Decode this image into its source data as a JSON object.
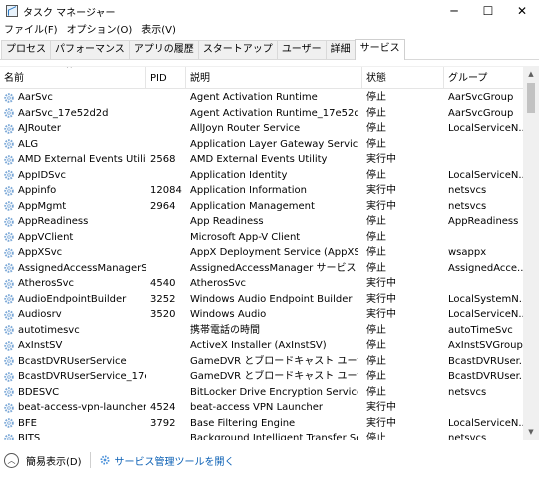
{
  "window": {
    "title": "タスク マネージャー",
    "minimize_glyph": "─",
    "maximize_glyph": "☐",
    "close_glyph": "✕"
  },
  "menu": [
    "ファイル(F)",
    "オプション(O)",
    "表示(V)"
  ],
  "tabs": [
    {
      "label": "プロセス",
      "active": false
    },
    {
      "label": "パフォーマンス",
      "active": false
    },
    {
      "label": "アプリの履歴",
      "active": false
    },
    {
      "label": "スタートアップ",
      "active": false
    },
    {
      "label": "ユーザー",
      "active": false
    },
    {
      "label": "詳細",
      "active": false
    },
    {
      "label": "サービス",
      "active": true
    }
  ],
  "columns": {
    "name": "名前",
    "pid": "PID",
    "description": "説明",
    "status": "状態",
    "group": "グループ",
    "sort_glyph": "^"
  },
  "rows": [
    {
      "name": "AarSvc",
      "pid": "",
      "description": "Agent Activation Runtime",
      "status": "停止",
      "group": "AarSvcGroup"
    },
    {
      "name": "AarSvc_17e52d2d",
      "pid": "",
      "description": "Agent Activation Runtime_17e52d2d",
      "status": "停止",
      "group": "AarSvcGroup"
    },
    {
      "name": "AJRouter",
      "pid": "",
      "description": "AllJoyn Router Service",
      "status": "停止",
      "group": "LocalServiceN..."
    },
    {
      "name": "ALG",
      "pid": "",
      "description": "Application Layer Gateway Service",
      "status": "停止",
      "group": ""
    },
    {
      "name": "AMD External Events Utility",
      "pid": "2568",
      "description": "AMD External Events Utility",
      "status": "実行中",
      "group": ""
    },
    {
      "name": "AppIDSvc",
      "pid": "",
      "description": "Application Identity",
      "status": "停止",
      "group": "LocalServiceN..."
    },
    {
      "name": "Appinfo",
      "pid": "12084",
      "description": "Application Information",
      "status": "実行中",
      "group": "netsvcs"
    },
    {
      "name": "AppMgmt",
      "pid": "2964",
      "description": "Application Management",
      "status": "実行中",
      "group": "netsvcs"
    },
    {
      "name": "AppReadiness",
      "pid": "",
      "description": "App Readiness",
      "status": "停止",
      "group": "AppReadiness"
    },
    {
      "name": "AppVClient",
      "pid": "",
      "description": "Microsoft App-V Client",
      "status": "停止",
      "group": ""
    },
    {
      "name": "AppXSvc",
      "pid": "",
      "description": "AppX Deployment Service (AppXSVC)",
      "status": "停止",
      "group": "wsappx"
    },
    {
      "name": "AssignedAccessManagerSvc",
      "pid": "",
      "description": "AssignedAccessManager サービス",
      "status": "停止",
      "group": "AssignedAcce..."
    },
    {
      "name": "AtherosSvc",
      "pid": "4540",
      "description": "AtherosSvc",
      "status": "実行中",
      "group": ""
    },
    {
      "name": "AudioEndpointBuilder",
      "pid": "3252",
      "description": "Windows Audio Endpoint Builder",
      "status": "実行中",
      "group": "LocalSystemN..."
    },
    {
      "name": "Audiosrv",
      "pid": "3520",
      "description": "Windows Audio",
      "status": "実行中",
      "group": "LocalServiceN..."
    },
    {
      "name": "autotimesvc",
      "pid": "",
      "description": "携帯電話の時間",
      "status": "停止",
      "group": "autoTimeSvc"
    },
    {
      "name": "AxInstSV",
      "pid": "",
      "description": "ActiveX Installer (AxInstSV)",
      "status": "停止",
      "group": "AxInstSVGroup"
    },
    {
      "name": "BcastDVRUserService",
      "pid": "",
      "description": "GameDVR とブロードキャスト ユーザー サー...",
      "status": "停止",
      "group": "BcastDVRUser..."
    },
    {
      "name": "BcastDVRUserService_17e52...",
      "pid": "",
      "description": "GameDVR とブロードキャスト ユーザー サー...",
      "status": "停止",
      "group": "BcastDVRUser..."
    },
    {
      "name": "BDESVC",
      "pid": "",
      "description": "BitLocker Drive Encryption Service",
      "status": "停止",
      "group": "netsvcs"
    },
    {
      "name": "beat-access-vpn-launcher",
      "pid": "4524",
      "description": "beat-access VPN Launcher",
      "status": "実行中",
      "group": ""
    },
    {
      "name": "BFE",
      "pid": "3792",
      "description": "Base Filtering Engine",
      "status": "実行中",
      "group": "LocalServiceN..."
    },
    {
      "name": "BITS",
      "pid": "",
      "description": "Background Intelligent Transfer Servi...",
      "status": "停止",
      "group": "netsvcs"
    }
  ],
  "footer": {
    "fewer_details": "簡易表示(D)",
    "open_services": "サービス管理ツールを開く"
  },
  "colors": {
    "link": "#0a5fb4",
    "gear": "#4a90d9"
  }
}
